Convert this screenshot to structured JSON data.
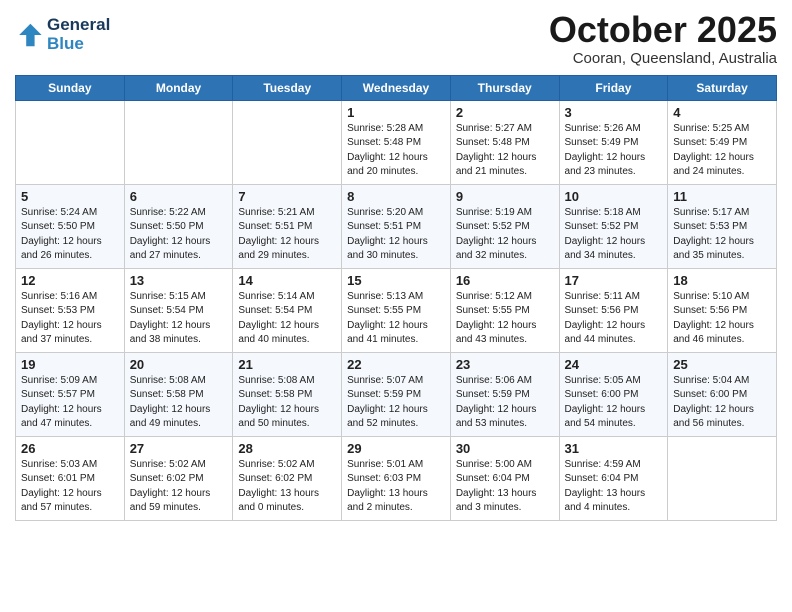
{
  "header": {
    "logo_line1": "General",
    "logo_line2": "Blue",
    "title": "October 2025",
    "location": "Cooran, Queensland, Australia"
  },
  "days_of_week": [
    "Sunday",
    "Monday",
    "Tuesday",
    "Wednesday",
    "Thursday",
    "Friday",
    "Saturday"
  ],
  "weeks": [
    [
      {
        "day": "",
        "info": ""
      },
      {
        "day": "",
        "info": ""
      },
      {
        "day": "",
        "info": ""
      },
      {
        "day": "1",
        "info": "Sunrise: 5:28 AM\nSunset: 5:48 PM\nDaylight: 12 hours\nand 20 minutes."
      },
      {
        "day": "2",
        "info": "Sunrise: 5:27 AM\nSunset: 5:48 PM\nDaylight: 12 hours\nand 21 minutes."
      },
      {
        "day": "3",
        "info": "Sunrise: 5:26 AM\nSunset: 5:49 PM\nDaylight: 12 hours\nand 23 minutes."
      },
      {
        "day": "4",
        "info": "Sunrise: 5:25 AM\nSunset: 5:49 PM\nDaylight: 12 hours\nand 24 minutes."
      }
    ],
    [
      {
        "day": "5",
        "info": "Sunrise: 5:24 AM\nSunset: 5:50 PM\nDaylight: 12 hours\nand 26 minutes."
      },
      {
        "day": "6",
        "info": "Sunrise: 5:22 AM\nSunset: 5:50 PM\nDaylight: 12 hours\nand 27 minutes."
      },
      {
        "day": "7",
        "info": "Sunrise: 5:21 AM\nSunset: 5:51 PM\nDaylight: 12 hours\nand 29 minutes."
      },
      {
        "day": "8",
        "info": "Sunrise: 5:20 AM\nSunset: 5:51 PM\nDaylight: 12 hours\nand 30 minutes."
      },
      {
        "day": "9",
        "info": "Sunrise: 5:19 AM\nSunset: 5:52 PM\nDaylight: 12 hours\nand 32 minutes."
      },
      {
        "day": "10",
        "info": "Sunrise: 5:18 AM\nSunset: 5:52 PM\nDaylight: 12 hours\nand 34 minutes."
      },
      {
        "day": "11",
        "info": "Sunrise: 5:17 AM\nSunset: 5:53 PM\nDaylight: 12 hours\nand 35 minutes."
      }
    ],
    [
      {
        "day": "12",
        "info": "Sunrise: 5:16 AM\nSunset: 5:53 PM\nDaylight: 12 hours\nand 37 minutes."
      },
      {
        "day": "13",
        "info": "Sunrise: 5:15 AM\nSunset: 5:54 PM\nDaylight: 12 hours\nand 38 minutes."
      },
      {
        "day": "14",
        "info": "Sunrise: 5:14 AM\nSunset: 5:54 PM\nDaylight: 12 hours\nand 40 minutes."
      },
      {
        "day": "15",
        "info": "Sunrise: 5:13 AM\nSunset: 5:55 PM\nDaylight: 12 hours\nand 41 minutes."
      },
      {
        "day": "16",
        "info": "Sunrise: 5:12 AM\nSunset: 5:55 PM\nDaylight: 12 hours\nand 43 minutes."
      },
      {
        "day": "17",
        "info": "Sunrise: 5:11 AM\nSunset: 5:56 PM\nDaylight: 12 hours\nand 44 minutes."
      },
      {
        "day": "18",
        "info": "Sunrise: 5:10 AM\nSunset: 5:56 PM\nDaylight: 12 hours\nand 46 minutes."
      }
    ],
    [
      {
        "day": "19",
        "info": "Sunrise: 5:09 AM\nSunset: 5:57 PM\nDaylight: 12 hours\nand 47 minutes."
      },
      {
        "day": "20",
        "info": "Sunrise: 5:08 AM\nSunset: 5:58 PM\nDaylight: 12 hours\nand 49 minutes."
      },
      {
        "day": "21",
        "info": "Sunrise: 5:08 AM\nSunset: 5:58 PM\nDaylight: 12 hours\nand 50 minutes."
      },
      {
        "day": "22",
        "info": "Sunrise: 5:07 AM\nSunset: 5:59 PM\nDaylight: 12 hours\nand 52 minutes."
      },
      {
        "day": "23",
        "info": "Sunrise: 5:06 AM\nSunset: 5:59 PM\nDaylight: 12 hours\nand 53 minutes."
      },
      {
        "day": "24",
        "info": "Sunrise: 5:05 AM\nSunset: 6:00 PM\nDaylight: 12 hours\nand 54 minutes."
      },
      {
        "day": "25",
        "info": "Sunrise: 5:04 AM\nSunset: 6:00 PM\nDaylight: 12 hours\nand 56 minutes."
      }
    ],
    [
      {
        "day": "26",
        "info": "Sunrise: 5:03 AM\nSunset: 6:01 PM\nDaylight: 12 hours\nand 57 minutes."
      },
      {
        "day": "27",
        "info": "Sunrise: 5:02 AM\nSunset: 6:02 PM\nDaylight: 12 hours\nand 59 minutes."
      },
      {
        "day": "28",
        "info": "Sunrise: 5:02 AM\nSunset: 6:02 PM\nDaylight: 13 hours\nand 0 minutes."
      },
      {
        "day": "29",
        "info": "Sunrise: 5:01 AM\nSunset: 6:03 PM\nDaylight: 13 hours\nand 2 minutes."
      },
      {
        "day": "30",
        "info": "Sunrise: 5:00 AM\nSunset: 6:04 PM\nDaylight: 13 hours\nand 3 minutes."
      },
      {
        "day": "31",
        "info": "Sunrise: 4:59 AM\nSunset: 6:04 PM\nDaylight: 13 hours\nand 4 minutes."
      },
      {
        "day": "",
        "info": ""
      }
    ]
  ]
}
